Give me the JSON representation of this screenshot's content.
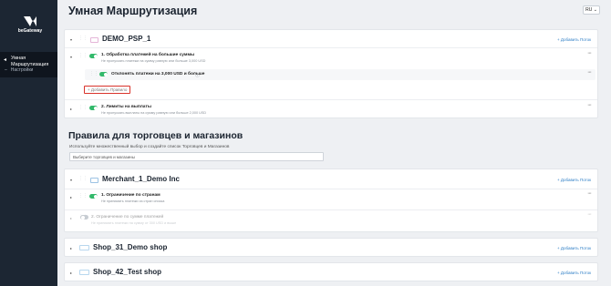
{
  "app": {
    "brand": "beGateway"
  },
  "sidebar": {
    "active_item": "Умная Маршрутизация",
    "sub_item": "Настройки"
  },
  "header": {
    "title": "Умная Маршрутизация",
    "lang": "RU ⌄"
  },
  "psp_card": {
    "title": "DEMO_PSP_1",
    "add_link": "+ Добавить Поток",
    "rule1": {
      "title": "1. Обработка платежей на большие суммы",
      "subtitle": "Не пропускать платежи на сумму равную или больше 3,000 USD"
    },
    "nested_rule": {
      "title": "Отклонять платежи на 3,000 USD и больше",
      "info": "ⓘ"
    },
    "add_rule": "+ Добавить Правило",
    "rule2": {
      "title": "2. Лимиты на выплаты",
      "subtitle": "Не пропускать выплаты на сумму равную или больше 2,000 USD"
    }
  },
  "merchants_section": {
    "title": "Правила для торговцев и магазинов",
    "hint": "Используйте множественный выбор и создайте список Торговцев и Магазинов",
    "select_placeholder": "Выберите торговцев и магазины"
  },
  "merchant_card": {
    "title": "Merchant_1_Demo Inc",
    "add_link": "+ Добавить Поток",
    "rule1": {
      "title": "1. Ограничение по странам",
      "subtitle": "Не принимать платежи из стран списка"
    },
    "rule2": {
      "title": "2. Ограничение по сумме платежей",
      "subtitle": "Не принимать платежи на сумму от 300 USD и выше"
    }
  },
  "shop_cards": [
    {
      "title": "Shop_31_Demo shop",
      "add_link": "+ Добавить Поток"
    },
    {
      "title": "Shop_42_Test shop",
      "add_link": "+ Добавить Поток"
    }
  ],
  "icons": {
    "expand": "chevron-down-icon",
    "drag": "drag-handle-icon",
    "menu": "more-dots-icon"
  },
  "colors": {
    "sidebar": "#1c2633",
    "toggle_on": "#33b96b",
    "link": "#2f7fc6",
    "highlight": "#d9332b"
  }
}
